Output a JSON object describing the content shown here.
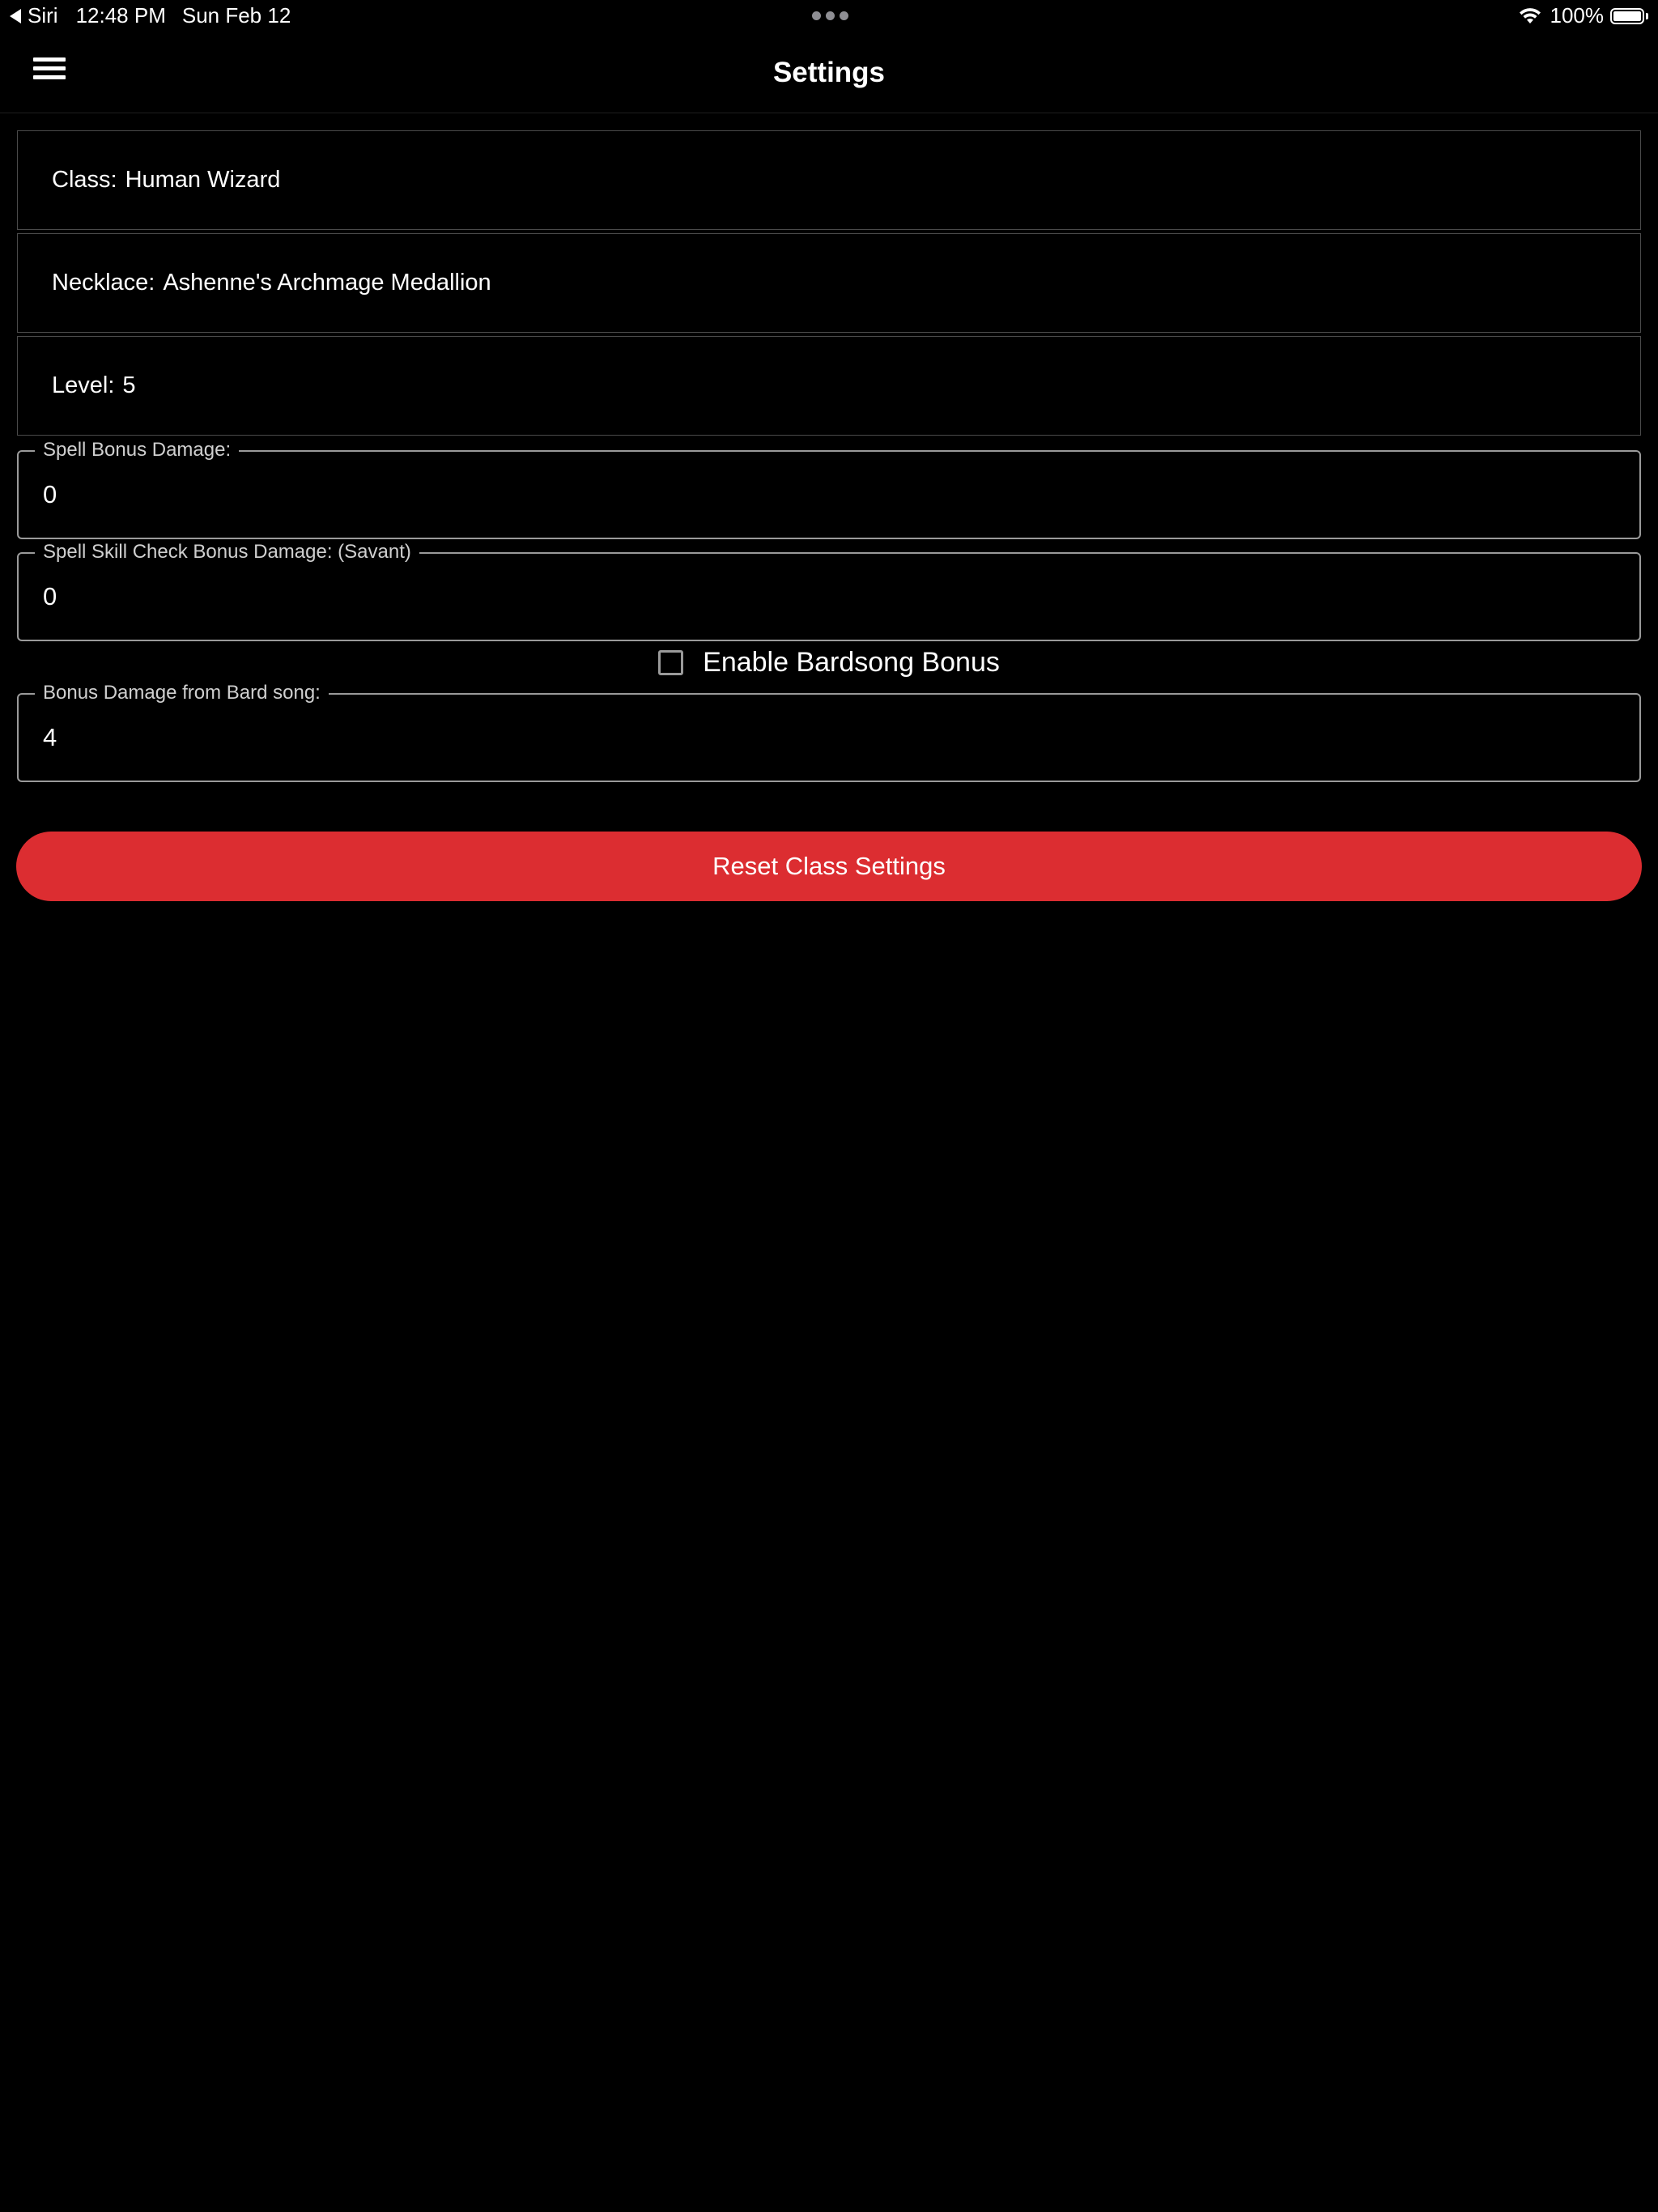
{
  "status_bar": {
    "back_app": "Siri",
    "time": "12:48 PM",
    "date": "Sun Feb 12",
    "battery": "100%",
    "battery_level": 1.0
  },
  "nav": {
    "title": "Settings",
    "menu_icon": "hamburger-menu-icon"
  },
  "settings": {
    "class": {
      "label": "Class:",
      "value": "Human Wizard"
    },
    "necklace": {
      "label": "Necklace:",
      "value": "Ashenne's Archmage Medallion"
    },
    "level": {
      "label": "Level:",
      "value": "5"
    }
  },
  "fields": {
    "spell_bonus_damage": {
      "label": "Spell Bonus Damage:",
      "value": "0"
    },
    "spell_skill_check_bonus": {
      "label": "Spell Skill Check Bonus Damage: (Savant)",
      "value": "0"
    },
    "bard_song_bonus": {
      "label": "Bonus Damage from Bard song:",
      "value": "4"
    }
  },
  "bardsong_checkbox": {
    "label": "Enable Bardsong Bonus",
    "checked": false
  },
  "reset_button": {
    "label": "Reset Class Settings",
    "color": "#dc2d31"
  }
}
